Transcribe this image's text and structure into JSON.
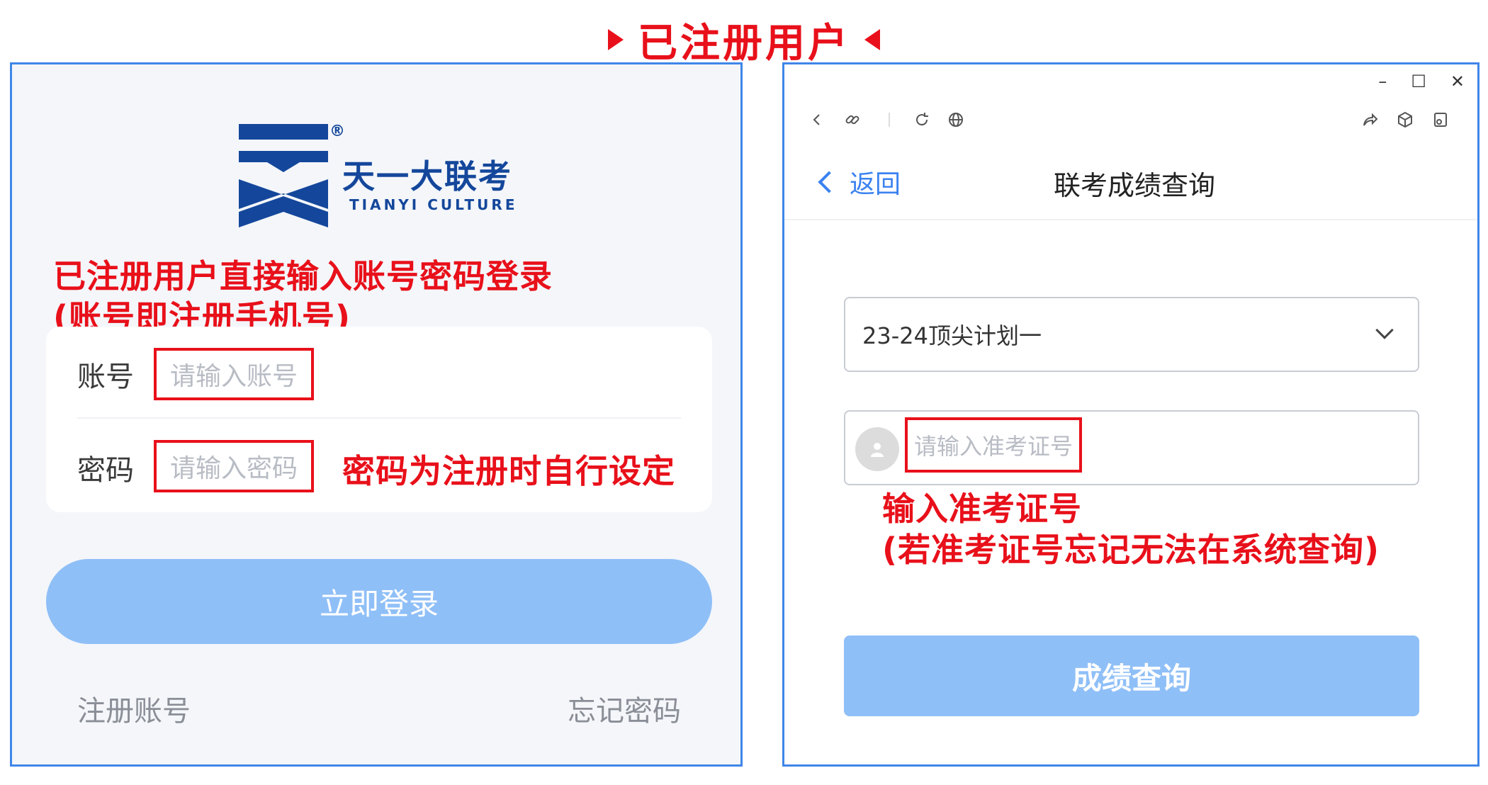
{
  "header": {
    "label": "已注册用户"
  },
  "login": {
    "brand_cn": "天一大联考",
    "brand_en": "TIANYI CULTURE",
    "reg_mark": "®",
    "note_line1": "已注册用户直接输入账号密码登录",
    "note_line2": "(账号即注册手机号)",
    "account_label": "账号",
    "account_placeholder": "请输入账号",
    "password_label": "密码",
    "password_placeholder": "请输入密码",
    "password_note": "密码为注册时自行设定",
    "login_button": "立即登录",
    "register_link": "注册账号",
    "forgot_link": "忘记密码"
  },
  "query": {
    "window_controls": [
      "–",
      "☐",
      "✕"
    ],
    "back_label": "返回",
    "title": "联考成绩查询",
    "exam_selected": "23-24顶尖计划一",
    "exam_no_placeholder": "请输入准考证号",
    "note_line1": "输入准考证号",
    "note_line2": "(若准考证号忘记无法在系统查询)",
    "query_button": "成绩查询"
  },
  "colors": {
    "annotation_red": "#e8101a",
    "panel_border": "#3f86e8",
    "brand_blue": "#14479b",
    "button_blue": "#8fbff7",
    "link_blue": "#3b82f0"
  }
}
